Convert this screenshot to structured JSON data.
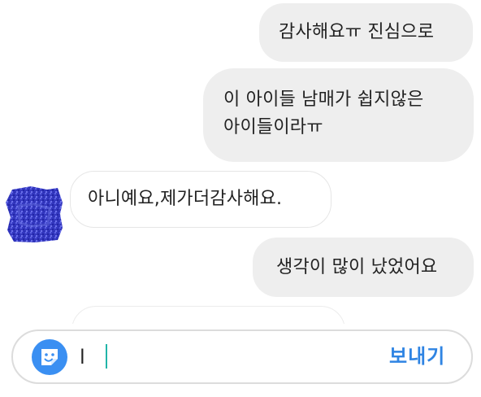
{
  "messages": [
    {
      "direction": "sent",
      "text": "감사해요ㅠ 진심으로"
    },
    {
      "direction": "sent",
      "text": "이 아이들 남매가 쉽지않은\n아이들이라ㅠ"
    },
    {
      "direction": "received",
      "text": "아니예요,제가더감사해요."
    },
    {
      "direction": "sent",
      "text": "생각이 많이 났었어요"
    }
  ],
  "composer": {
    "input_value": "l",
    "send_label": "보내기",
    "sticker_icon": "sticker-face-icon"
  },
  "colors": {
    "sent_bubble": "#eeeeee",
    "received_border": "#e6e6e6",
    "send_text": "#2f84e3",
    "sticker_button": "#3a8ff2",
    "caret": "#21b5a8",
    "avatar": "#3a42c8"
  }
}
